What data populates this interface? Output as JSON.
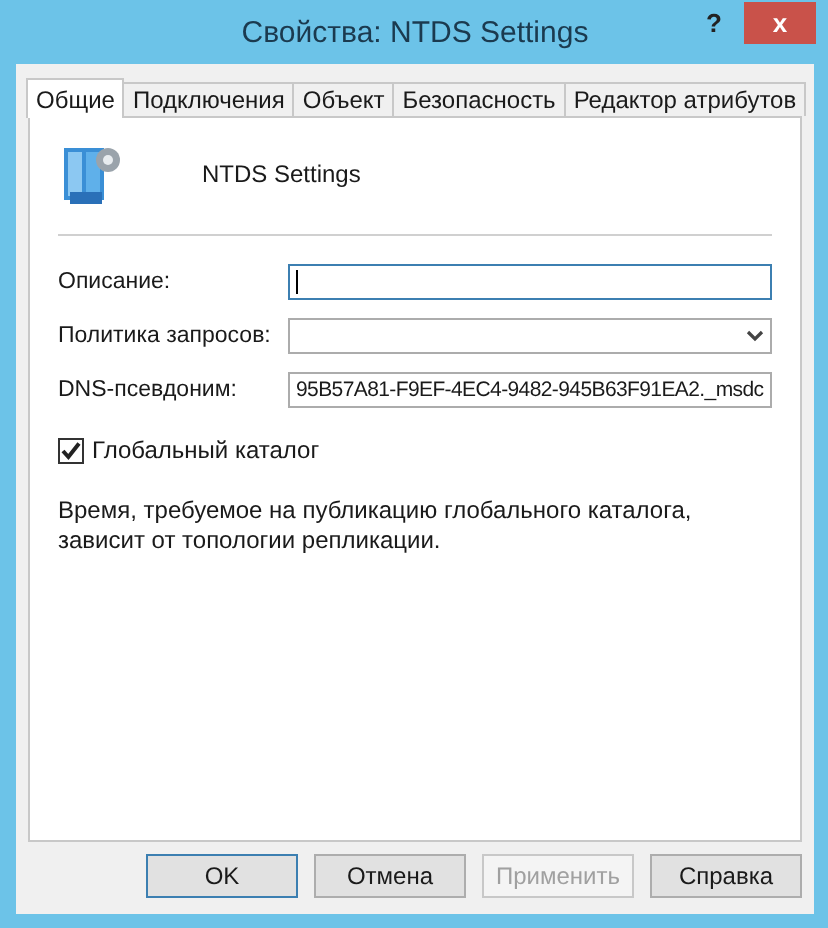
{
  "window": {
    "title": "Свойства: NTDS Settings",
    "help_button": "?",
    "close_button": "x"
  },
  "tabs": [
    {
      "label": "Общие",
      "selected": true
    },
    {
      "label": "Подключения",
      "selected": false
    },
    {
      "label": "Объект",
      "selected": false
    },
    {
      "label": "Безопасность",
      "selected": false
    },
    {
      "label": "Редактор атрибутов",
      "selected": false
    }
  ],
  "object_name": "NTDS Settings",
  "fields": [
    {
      "kind": "text",
      "label": "Описание:",
      "focused": true
    },
    {
      "kind": "dropdown",
      "label": "Политика запросов:",
      "focused": false
    },
    {
      "kind": "text",
      "label": "DNS-псевдоним:",
      "value": "95B57A81-F9EF-4EC4-9482-945B63F91EA2._msdc",
      "focused": false
    }
  ],
  "global_catalog": {
    "label": "Глобальный каталог",
    "checked": true
  },
  "note": "Время, требуемое на публикацию глобального каталога, зависит от топологии репликации.",
  "buttons": [
    {
      "label": "OK",
      "default": true,
      "disabled": false
    },
    {
      "label": "Отмена",
      "default": false,
      "disabled": false
    },
    {
      "label": "Применить",
      "default": false,
      "disabled": true
    },
    {
      "label": "Справка",
      "default": false,
      "disabled": false
    }
  ]
}
